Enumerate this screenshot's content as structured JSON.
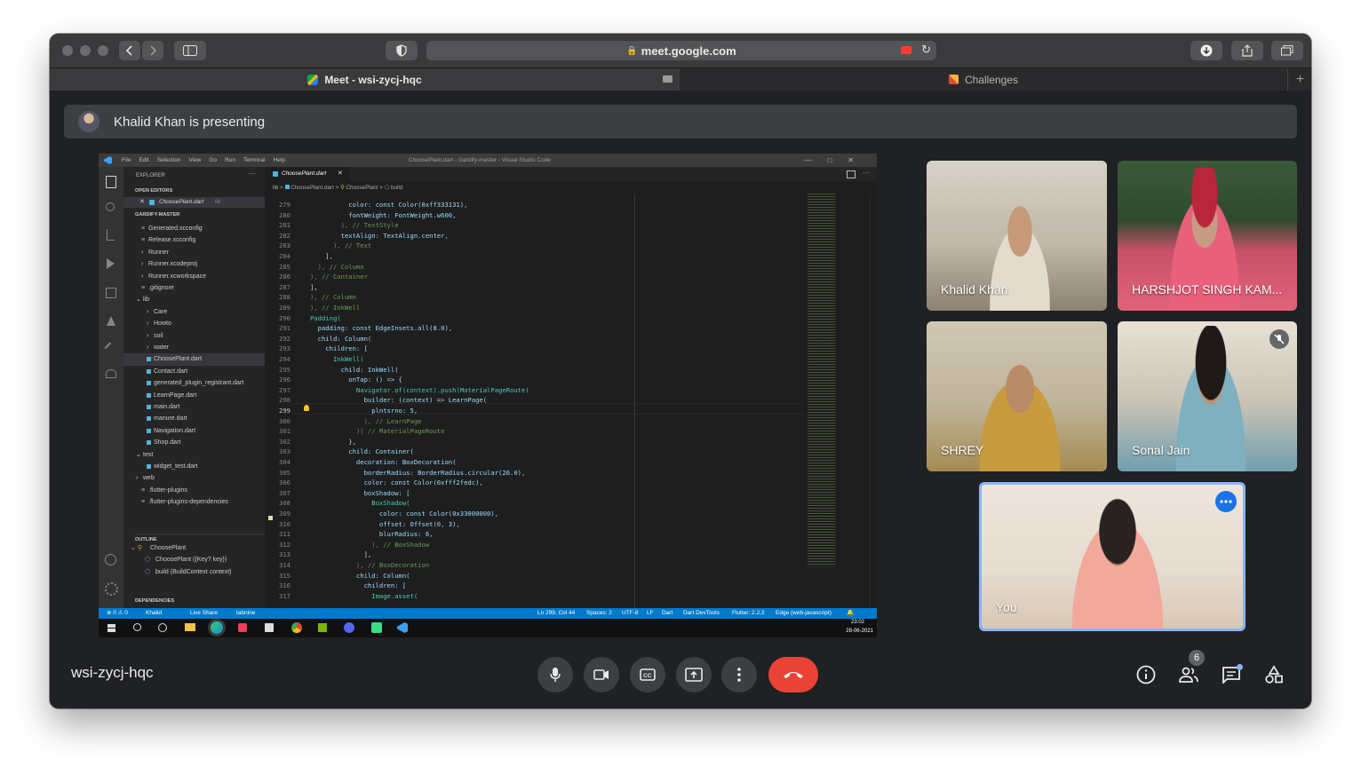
{
  "browser": {
    "url": "meet.google.com",
    "tabs": [
      {
        "label": "Meet - wsi-zycj-hqc",
        "active": true
      },
      {
        "label": "Challenges",
        "active": false
      }
    ],
    "new_tab": "+"
  },
  "meet": {
    "presenting_banner": "Khalid Khan is presenting",
    "meeting_code": "wsi-zycj-hqc",
    "participant_count": "6",
    "participants": [
      {
        "name": "Khalid Khan",
        "bg": "#c9c2b5"
      },
      {
        "name": "HARSHJOT SINGH KAM...",
        "bg": "#d9536a"
      },
      {
        "name": "SHREY",
        "bg": "#c9bc9c"
      },
      {
        "name": "Sonal Jain",
        "bg": "#7fa9b3",
        "muted": true
      },
      {
        "name": "You",
        "bg": "#e8ddd2"
      }
    ],
    "colors": {
      "end_call": "#ea4335",
      "accent": "#1a73e8",
      "self_border": "#8ab4f8"
    }
  },
  "vscode": {
    "menu": [
      "File",
      "Edit",
      "Selection",
      "View",
      "Go",
      "Run",
      "Terminal",
      "Help"
    ],
    "window_title": "ChoosePlant.dart - Gardify-master - Visual Studio Code",
    "explorer_title": "EXPLORER",
    "open_editors": "OPEN EDITORS",
    "open_file": "ChoosePlant.dart",
    "open_file_dir": "lib",
    "project": "GARDIFY-MASTER",
    "tree": [
      "Generated.xcconfig",
      "Release.xcconfig",
      "Runner",
      "Runner.xcodeproj",
      "Runner.xcworkspace",
      ".gitignore",
      "lib",
      "Care",
      "Howto",
      "soil",
      "water",
      "ChoosePlant.dart",
      "Contact.dart",
      "generated_plugin_registrant.dart",
      "LearnPage.dart",
      "main.dart",
      "manure.dart",
      "Navigation.dart",
      "Shop.dart",
      "test",
      "widget_test.dart",
      "web",
      ".flutter-plugins",
      ".flutter-plugins-dependencies"
    ],
    "outline_title": "OUTLINE",
    "outline": [
      "ChoosePlant",
      "ChoosePlant ({Key? key})",
      "build (BuildContext context)"
    ],
    "dependencies": "DEPENDENCIES",
    "editor_tab": "ChoosePlant.dart",
    "breadcrumb": [
      "lib",
      "ChoosePlant.dart",
      "ChoosePlant",
      "build"
    ],
    "code_lines": [
      {
        "n": "279",
        "t": "          color: const Color(0xff333131),"
      },
      {
        "n": "280",
        "t": "          fontWeight: FontWeight.w600,"
      },
      {
        "n": "281",
        "t": "        ), // TextStyle"
      },
      {
        "n": "282",
        "t": "        textAlign: TextAlign.center,"
      },
      {
        "n": "283",
        "t": "      ), // Text"
      },
      {
        "n": "284",
        "t": "    ],"
      },
      {
        "n": "285",
        "t": "  ), // Column"
      },
      {
        "n": "286",
        "t": "), // Container"
      },
      {
        "n": "287",
        "t": "],"
      },
      {
        "n": "288",
        "t": "), // Column"
      },
      {
        "n": "289",
        "t": "), // InkWell"
      },
      {
        "n": "290",
        "t": "Padding("
      },
      {
        "n": "291",
        "t": "  padding: const EdgeInsets.all(8.0),"
      },
      {
        "n": "292",
        "t": "  child: Column("
      },
      {
        "n": "293",
        "t": "    children: ["
      },
      {
        "n": "294",
        "t": "      InkWell("
      },
      {
        "n": "295",
        "t": "        child: InkWell("
      },
      {
        "n": "296",
        "t": "          onTap: () => {"
      },
      {
        "n": "297",
        "t": "            Navigator.of(context).push(MaterialPageRoute("
      },
      {
        "n": "298",
        "t": "              builder: (context) => LearnPage("
      },
      {
        "n": "299",
        "t": "                plntsrno: 5,"
      },
      {
        "n": "300",
        "t": "              ), // LearnPage"
      },
      {
        "n": "301",
        "t": "            )) // MaterialPageRoute"
      },
      {
        "n": "302",
        "t": "          },"
      },
      {
        "n": "303",
        "t": "          child: Container("
      },
      {
        "n": "304",
        "t": "            decoration: BoxDecoration("
      },
      {
        "n": "305",
        "t": "              borderRadius: BorderRadius.circular(26.0),"
      },
      {
        "n": "306",
        "t": "              color: const Color(0xfff2fedc),"
      },
      {
        "n": "307",
        "t": "              boxShadow: ["
      },
      {
        "n": "308",
        "t": "                BoxShadow("
      },
      {
        "n": "309",
        "t": "                  color: const Color(0x33000000),"
      },
      {
        "n": "310",
        "t": "                  offset: Offset(0, 3),"
      },
      {
        "n": "311",
        "t": "                  blurRadius: 6,"
      },
      {
        "n": "312",
        "t": "                ), // BoxShadow"
      },
      {
        "n": "313",
        "t": "              ],"
      },
      {
        "n": "314",
        "t": "            ), // BoxDecoration"
      },
      {
        "n": "315",
        "t": "            child: Column("
      },
      {
        "n": "316",
        "t": "              children: ["
      },
      {
        "n": "317",
        "t": "                Image.asset("
      }
    ],
    "status": {
      "problems": "⊗ 0 ⚠ 0",
      "user": "Khalid",
      "liveshare": "Live Share",
      "tabnine": "tabnine",
      "position": "Ln 299, Col 44",
      "spaces": "Spaces: 2",
      "encoding": "UTF-8",
      "eol": "LF",
      "language": "Dart",
      "devtools": "Dart DevTools",
      "flutter": "Flutter: 2.2.2",
      "device": "Edge (web-javascript)"
    },
    "taskbar": {
      "time": "23:02",
      "date": "28-06-2021"
    }
  }
}
